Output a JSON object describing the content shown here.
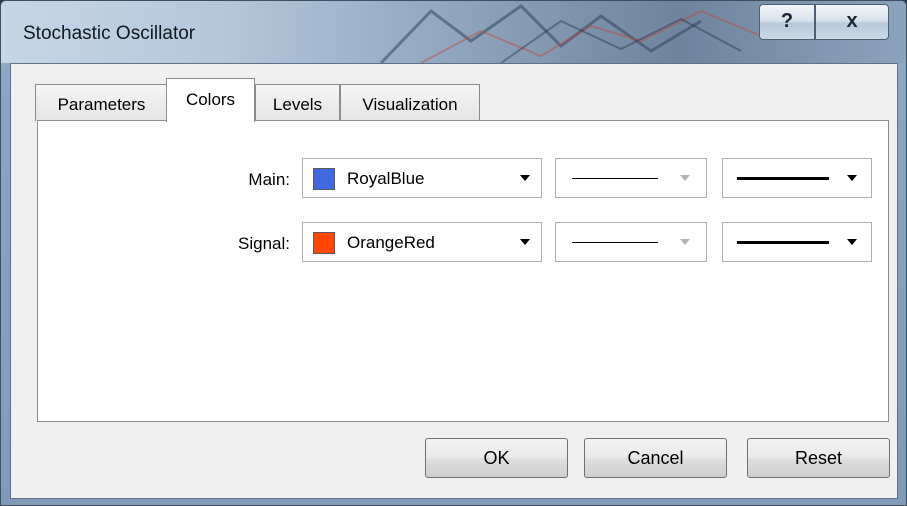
{
  "window": {
    "title": "Stochastic Oscillator",
    "help_label": "?",
    "close_label": "x"
  },
  "tabs": [
    {
      "label": "Parameters",
      "active": false
    },
    {
      "label": "Colors",
      "active": true
    },
    {
      "label": "Levels",
      "active": false
    },
    {
      "label": "Visualization",
      "active": false
    }
  ],
  "rows": [
    {
      "label": "Main:",
      "color_name": "RoyalBlue",
      "swatch_color": "#4169E1",
      "line_style": "solid",
      "line_style_enabled": false,
      "line_width": "thick"
    },
    {
      "label": "Signal:",
      "color_name": "OrangeRed",
      "swatch_color": "#FF4500",
      "line_style": "solid",
      "line_style_enabled": false,
      "line_width": "thick"
    }
  ],
  "buttons": {
    "ok": "OK",
    "cancel": "Cancel",
    "reset": "Reset"
  }
}
